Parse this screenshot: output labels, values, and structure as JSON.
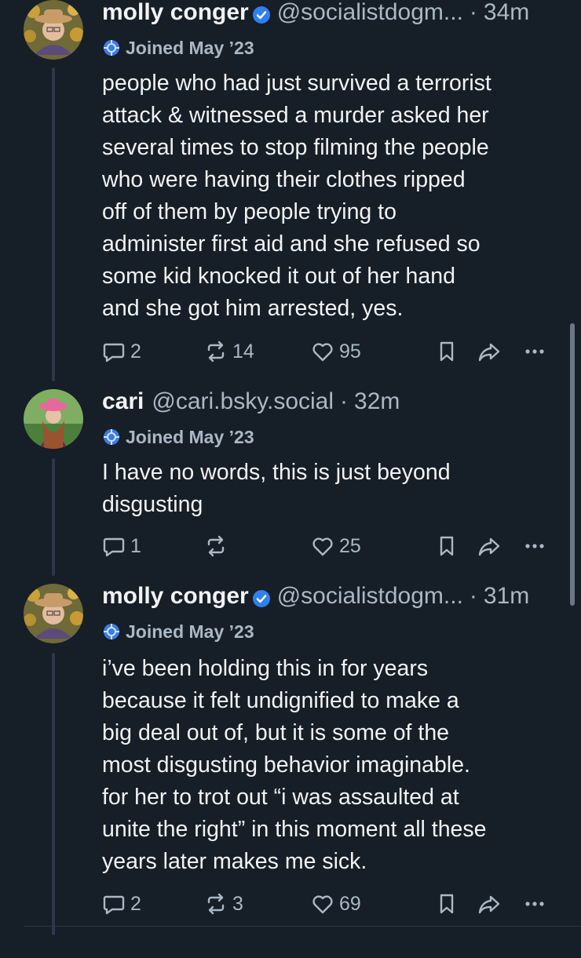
{
  "posts": [
    {
      "display_name": "molly conger",
      "verified": true,
      "handle": "@socialistdogm...",
      "separator": "·",
      "time": "34m",
      "joined": "Joined May ’23",
      "text_lines": [
        "people who had just survived a terrorist",
        "attack & witnessed a murder asked her",
        "several times to stop filming the people",
        "who were having their clothes ripped",
        "off of them by people trying to",
        "administer first aid and she refused so",
        "some kid knocked it out of her hand",
        "and she got him arrested, yes."
      ],
      "replies": "2",
      "reposts": "14",
      "likes": "95"
    },
    {
      "display_name": "cari",
      "verified": false,
      "handle": "@cari.bsky.social",
      "separator": "·",
      "time": "32m",
      "joined": "Joined May ’23",
      "text_lines": [
        "I have no words, this is just beyond",
        "disgusting"
      ],
      "replies": "1",
      "reposts": "",
      "likes": "25"
    },
    {
      "display_name": "molly conger",
      "verified": true,
      "handle": "@socialistdogm...",
      "separator": "·",
      "time": "31m",
      "joined": "Joined May ’23",
      "text_lines": [
        "i’ve been holding this in for years",
        "because it felt undignified to make a",
        "big deal out of, but it is some of the",
        "most disgusting behavior imaginable.",
        "for her to trot out “i was assaulted at",
        "unite the right” in this moment all these",
        "years later makes me sick."
      ],
      "replies": "2",
      "reposts": "3",
      "likes": "69"
    }
  ],
  "icons": {
    "reply": "speech-bubble-icon",
    "repost": "repost-arrows-icon",
    "like": "heart-icon",
    "bookmark": "bookmark-icon",
    "share": "share-arrow-icon",
    "more": "more-dots-icon",
    "joined": "new-user-badge-icon",
    "verified": "verified-check-icon"
  },
  "colors": {
    "background": "#161e27",
    "text": "#f1f3f5",
    "muted": "#aab8c5",
    "verified": "#2f80ed",
    "thread_line": "#2c3848"
  }
}
